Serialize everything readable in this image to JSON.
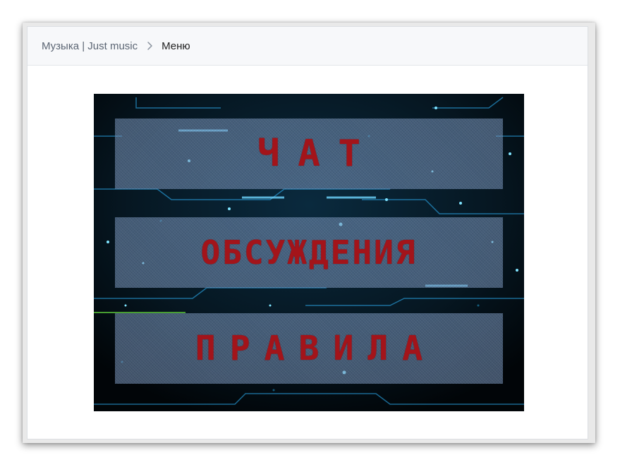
{
  "breadcrumb": {
    "parent": "Музыка | Just music",
    "separator_icon": "chevron-right-icon",
    "current": "Меню"
  },
  "menu": {
    "buttons": [
      {
        "label": "ЧАТ"
      },
      {
        "label": "ОБСУЖДЕНИЯ"
      },
      {
        "label": "ПРАВИЛА"
      }
    ]
  },
  "colors": {
    "label_red": "#a3141a",
    "panel_blue": "#7896be",
    "background_dark": "#03101a",
    "circuit_cyan": "#2fb8ff"
  }
}
